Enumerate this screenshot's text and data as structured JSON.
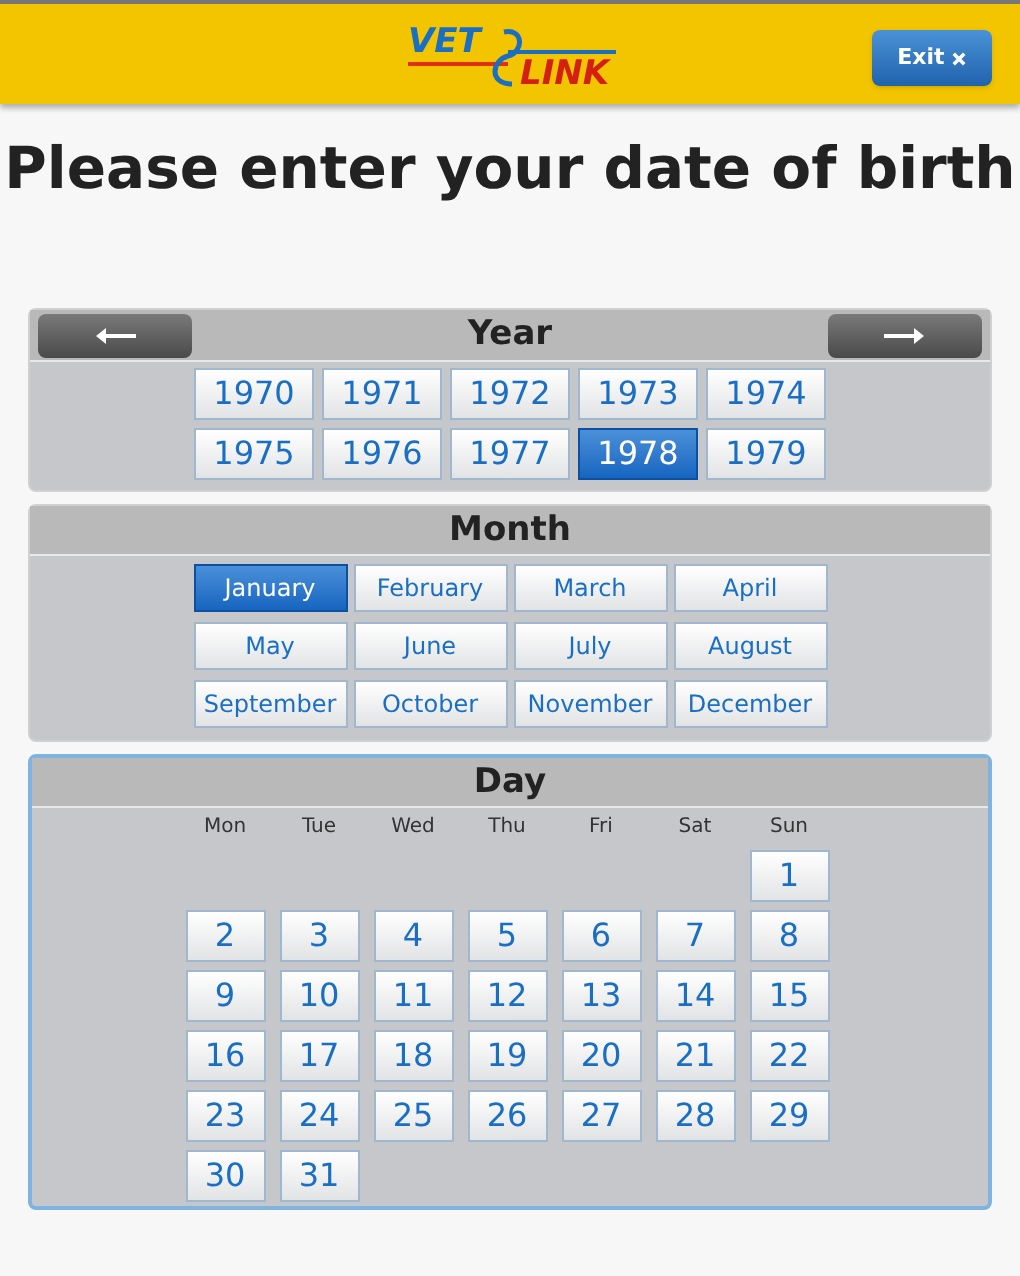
{
  "header": {
    "logo": {
      "word_1": "VET",
      "word_2": "LINK"
    },
    "exit_button": "Exit"
  },
  "title": "Please enter your date of birth",
  "year": {
    "title": "Year",
    "years": [
      {
        "label": "1970",
        "selected": false
      },
      {
        "label": "1971",
        "selected": false
      },
      {
        "label": "1972",
        "selected": false
      },
      {
        "label": "1973",
        "selected": false
      },
      {
        "label": "1974",
        "selected": false
      },
      {
        "label": "1975",
        "selected": false
      },
      {
        "label": "1976",
        "selected": false
      },
      {
        "label": "1977",
        "selected": false
      },
      {
        "label": "1978",
        "selected": true
      },
      {
        "label": "1979",
        "selected": false
      }
    ]
  },
  "month": {
    "title": "Month",
    "months": [
      {
        "label": "January",
        "selected": true
      },
      {
        "label": "February",
        "selected": false
      },
      {
        "label": "March",
        "selected": false
      },
      {
        "label": "April",
        "selected": false
      },
      {
        "label": "May",
        "selected": false
      },
      {
        "label": "June",
        "selected": false
      },
      {
        "label": "July",
        "selected": false
      },
      {
        "label": "August",
        "selected": false
      },
      {
        "label": "September",
        "selected": false
      },
      {
        "label": "October",
        "selected": false
      },
      {
        "label": "November",
        "selected": false
      },
      {
        "label": "December",
        "selected": false
      }
    ]
  },
  "day": {
    "title": "Day",
    "weekdays": [
      "Mon",
      "Tue",
      "Wed",
      "Thu",
      "Fri",
      "Sat",
      "Sun"
    ],
    "weeks": [
      [
        {
          "label": "1",
          "selected": false
        }
      ],
      [
        {
          "label": "2",
          "selected": false
        },
        {
          "label": "3",
          "selected": false
        },
        {
          "label": "4",
          "selected": false
        },
        {
          "label": "5",
          "selected": false
        },
        {
          "label": "6",
          "selected": false
        },
        {
          "label": "7",
          "selected": false
        },
        {
          "label": "8",
          "selected": false
        }
      ],
      [
        {
          "label": "9",
          "selected": false
        },
        {
          "label": "10",
          "selected": false
        },
        {
          "label": "11",
          "selected": false
        },
        {
          "label": "12",
          "selected": false
        },
        {
          "label": "13",
          "selected": false
        },
        {
          "label": "14",
          "selected": false
        },
        {
          "label": "15",
          "selected": false
        }
      ],
      [
        {
          "label": "16",
          "selected": false
        },
        {
          "label": "17",
          "selected": false
        },
        {
          "label": "18",
          "selected": false
        },
        {
          "label": "19",
          "selected": false
        },
        {
          "label": "20",
          "selected": false
        },
        {
          "label": "21",
          "selected": false
        },
        {
          "label": "22",
          "selected": false
        }
      ],
      [
        {
          "label": "23",
          "selected": false
        },
        {
          "label": "24",
          "selected": false
        },
        {
          "label": "25",
          "selected": false
        },
        {
          "label": "26",
          "selected": false
        },
        {
          "label": "27",
          "selected": false
        },
        {
          "label": "28",
          "selected": false
        },
        {
          "label": "29",
          "selected": false
        }
      ],
      [
        {
          "label": "30",
          "selected": false
        },
        {
          "label": "31",
          "selected": false
        }
      ]
    ]
  }
}
